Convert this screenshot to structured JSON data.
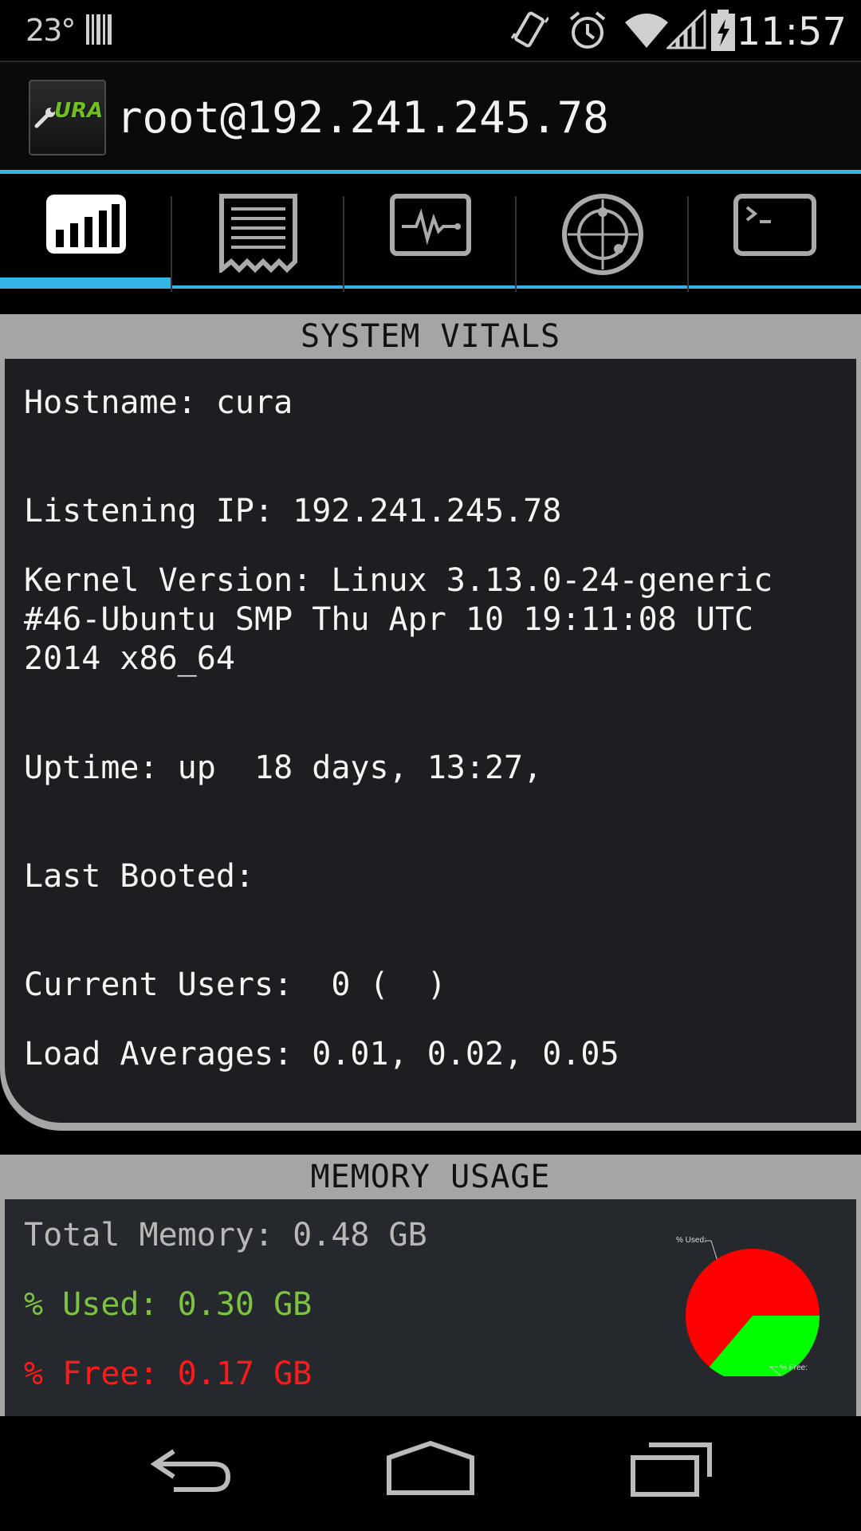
{
  "status_bar": {
    "temperature": "23°",
    "time": "11:57",
    "icons": [
      "barcode-icon",
      "vibrate-icon",
      "alarm-icon",
      "wifi-icon",
      "signal-icon",
      "battery-charging-icon"
    ]
  },
  "action_bar": {
    "logo_text": "URA",
    "title": "root@192.241.245.78"
  },
  "tabs": [
    {
      "icon": "bar-chart-icon",
      "active": true
    },
    {
      "icon": "log-receipt-icon",
      "active": false
    },
    {
      "icon": "monitor-pulse-icon",
      "active": false
    },
    {
      "icon": "radar-icon",
      "active": false
    },
    {
      "icon": "terminal-icon",
      "active": false
    }
  ],
  "vitals": {
    "header": "SYSTEM VITALS",
    "hostname": "Hostname: cura",
    "listening_ip": "Listening IP: 192.241.245.78",
    "kernel_line1": "Kernel Version: Linux 3.13.0-24-generic",
    "kernel_line2": "#46-Ubuntu SMP Thu Apr 10 19:11:08 UTC",
    "kernel_line3": "2014 x86_64",
    "uptime": "Uptime: up  18 days, 13:27,",
    "last_booted": "Last Booted:",
    "current_users": "Current Users:  0 (  )",
    "load_averages": "Load Averages: 0.01, 0.02, 0.05"
  },
  "memory": {
    "header": "MEMORY USAGE",
    "total": "Total Memory: 0.48 GB",
    "used": "% Used: 0.30 GB",
    "free": "% Free: 0.17 GB",
    "colors": {
      "total": "#b8b8b8",
      "used": "#7dc242",
      "free": "#ff1a1a"
    }
  },
  "chart_data": {
    "type": "pie",
    "labels": [
      "% Used:",
      "% Free:"
    ],
    "values": [
      0.3,
      0.17
    ],
    "colors": [
      "#ff0000",
      "#00ff00"
    ]
  },
  "nav_bar": {
    "buttons": [
      "back-icon",
      "home-icon",
      "recents-icon"
    ]
  }
}
